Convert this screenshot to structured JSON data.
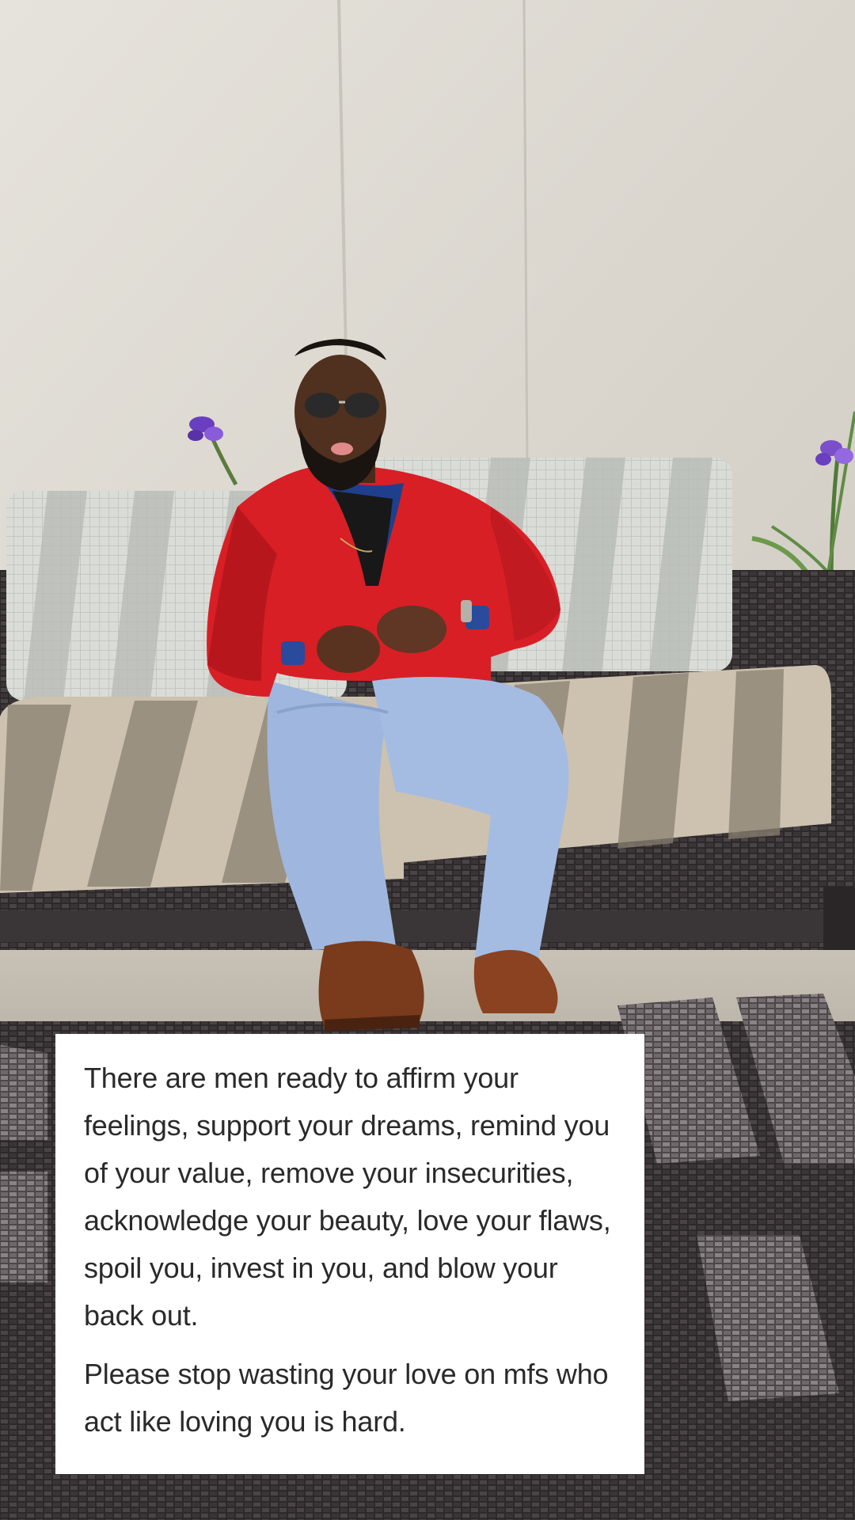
{
  "caption": {
    "paragraph_1": "There are men ready to affirm your feelings, support your dreams, remind you of your value, remove your insecurities, acknowledge your beauty, love your flaws, spoil you, invest in you, and blow your back out.",
    "paragraph_2": "Please stop wasting your love on mfs who act like loving you is hard."
  },
  "colors": {
    "wall": "#dedad3",
    "jacket": "#d81f26",
    "shirt": "#1f3f8c",
    "pants": "#9db6dc",
    "shoes": "#7a3a1c",
    "cushion": "#c9bfae",
    "back_cushion": "#d6d9d4",
    "wicker": "#2e2a2b",
    "flower": "#7a4fc9",
    "caption_bg": "#ffffff",
    "caption_text": "#2a2a2a"
  }
}
